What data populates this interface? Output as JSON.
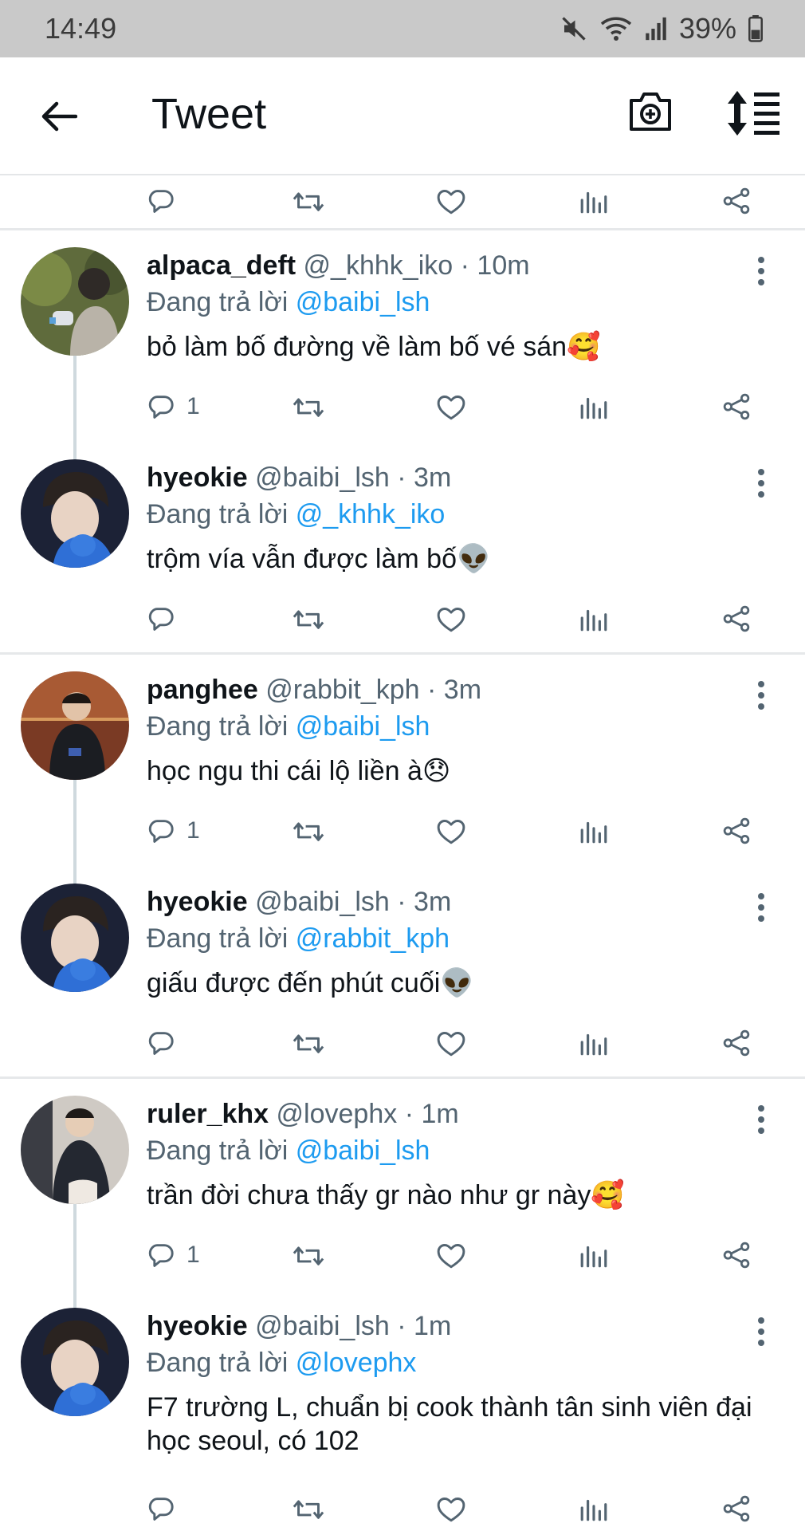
{
  "status": {
    "time": "14:49",
    "battery": "39%"
  },
  "header": {
    "title": "Tweet"
  },
  "tweets": [
    {
      "name": "alpaca_deft",
      "handle": "@_khhk_iko",
      "time": "10m",
      "reply_prefix": "Đang trả lời",
      "reply_to": "@baibi_lsh",
      "text": "bỏ làm bố đường về làm bố vé sán🥰",
      "replies": "1"
    },
    {
      "name": "hyeokie",
      "handle": "@baibi_lsh",
      "time": "3m",
      "reply_prefix": "Đang trả lời",
      "reply_to": "@_khhk_iko",
      "text": "trộm vía vẫn được làm bố👽",
      "replies": ""
    },
    {
      "name": "panghee",
      "handle": "@rabbit_kph",
      "time": "3m",
      "reply_prefix": "Đang trả lời",
      "reply_to": "@baibi_lsh",
      "text": "học ngu thi cái lộ liền à😞",
      "replies": "1"
    },
    {
      "name": "hyeokie",
      "handle": "@baibi_lsh",
      "time": "3m",
      "reply_prefix": "Đang trả lời",
      "reply_to": "@rabbit_kph",
      "text": "giấu được đến phút cuối👽",
      "replies": ""
    },
    {
      "name": "ruler_khx",
      "handle": "@lovephx",
      "time": "1m",
      "reply_prefix": "Đang trả lời",
      "reply_to": "@baibi_lsh",
      "text": "trần đời chưa thấy gr nào như gr này🥰",
      "replies": "1"
    },
    {
      "name": "hyeokie",
      "handle": "@baibi_lsh",
      "time": "1m",
      "reply_prefix": "Đang trả lời",
      "reply_to": "@lovephx",
      "text": "F7 trường L, chuẩn bị cook thành tân sinh viên đại học seoul, có 102",
      "replies": ""
    }
  ],
  "icons": {
    "reply": "reply-icon",
    "retweet": "retweet-icon",
    "like": "heart-icon",
    "views": "views-icon",
    "share": "share-icon"
  },
  "colors": {
    "accent": "#1d9bf0",
    "muted": "#536471",
    "text": "#0f1419"
  }
}
